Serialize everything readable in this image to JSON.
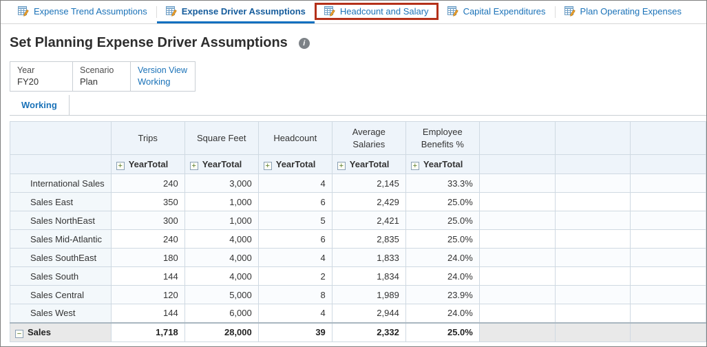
{
  "tab_bar": {
    "tabs": [
      {
        "label": "Expense Trend Assumptions"
      },
      {
        "label": "Expense Driver Assumptions"
      },
      {
        "label": "Headcount and Salary"
      },
      {
        "label": "Capital Expenditures"
      },
      {
        "label": "Plan Operating Expenses"
      }
    ],
    "active_tab": "Expense Driver Assumptions",
    "highlighted_tab": "Headcount and Salary"
  },
  "header": {
    "title": "Set Planning Expense Driver Assumptions"
  },
  "pov": {
    "items": [
      {
        "dimension": "Year",
        "member": "FY20",
        "is_link": false
      },
      {
        "dimension": "Scenario",
        "member": "Plan",
        "is_link": false
      },
      {
        "dimension": "Version View",
        "member": "Working",
        "is_link": true
      }
    ]
  },
  "subtabs": {
    "active": "Working"
  },
  "grid": {
    "column_headers": [
      "Trips",
      "Square Feet",
      "Headcount",
      "Average Salaries",
      "Employee Benefits %"
    ],
    "period_header": "YearTotal",
    "empty_columns": 3,
    "rows": [
      {
        "name": "International Sales",
        "values": [
          "240",
          "3,000",
          "4",
          "2,145",
          "33.3%"
        ]
      },
      {
        "name": "Sales East",
        "values": [
          "350",
          "1,000",
          "6",
          "2,429",
          "25.0%"
        ]
      },
      {
        "name": "Sales NorthEast",
        "values": [
          "300",
          "1,000",
          "5",
          "2,421",
          "25.0%"
        ]
      },
      {
        "name": "Sales Mid-Atlantic",
        "values": [
          "240",
          "4,000",
          "6",
          "2,835",
          "25.0%"
        ]
      },
      {
        "name": "Sales SouthEast",
        "values": [
          "180",
          "4,000",
          "4",
          "1,833",
          "24.0%"
        ]
      },
      {
        "name": "Sales South",
        "values": [
          "144",
          "4,000",
          "2",
          "1,834",
          "24.0%"
        ]
      },
      {
        "name": "Sales Central",
        "values": [
          "120",
          "5,000",
          "8",
          "1,989",
          "23.9%"
        ]
      },
      {
        "name": "Sales West",
        "values": [
          "144",
          "6,000",
          "4",
          "2,944",
          "24.0%"
        ]
      }
    ],
    "total_row": {
      "name": "Sales",
      "values": [
        "1,718",
        "28,000",
        "39",
        "2,332",
        "25.0%"
      ]
    }
  },
  "colors": {
    "link_blue": "#1a72b8",
    "active_tab_underline": "#0d6fc0",
    "highlight_red": "#b43019",
    "grid_header_bg": "#eef4fa",
    "grid_border": "#cfd9e2",
    "total_row_bg": "#e9e9e9"
  }
}
